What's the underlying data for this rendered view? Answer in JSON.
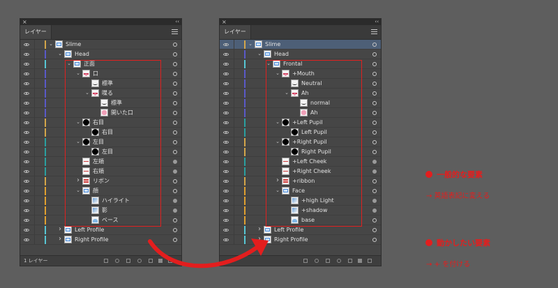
{
  "panel_left": {
    "tab": "レイヤー",
    "footer_count": "1 レイヤー",
    "rows": [
      {
        "label": "Slime",
        "level": 0,
        "chev": "down",
        "thumb": "blue",
        "color": "#d4a64a",
        "target": "hollow"
      },
      {
        "label": "Head",
        "level": 1,
        "chev": "down",
        "thumb": "blue",
        "color": "#5a59c9",
        "target": "hollow"
      },
      {
        "label": "正面",
        "level": 2,
        "chev": "down",
        "thumb": "blue",
        "color": "#57c7d4",
        "target": "hollow"
      },
      {
        "label": "口",
        "level": 3,
        "chev": "down",
        "thumb": "mouth",
        "color": "#5a59c9",
        "target": "hollow"
      },
      {
        "label": "標準",
        "level": 4,
        "chev": "",
        "thumb": "wave",
        "color": "#5a59c9",
        "target": "hollow"
      },
      {
        "label": "喋る",
        "level": 4,
        "chev": "down",
        "thumb": "mouth",
        "color": "#5a59c9",
        "target": "hollow"
      },
      {
        "label": "標準",
        "level": 5,
        "chev": "",
        "thumb": "wave",
        "color": "#5a59c9",
        "target": "hollow"
      },
      {
        "label": "開いた口",
        "level": 5,
        "chev": "",
        "thumb": "pink",
        "color": "#5a59c9",
        "target": "hollow"
      },
      {
        "label": "右目",
        "level": 3,
        "chev": "down",
        "thumb": "eye",
        "color": "#d4a64a",
        "target": "hollow"
      },
      {
        "label": "右目",
        "level": 4,
        "chev": "",
        "thumb": "eye",
        "color": "#d4a64a",
        "target": "hollow"
      },
      {
        "label": "左目",
        "level": 3,
        "chev": "down",
        "thumb": "eye",
        "color": "#2aa0a0",
        "target": "hollow"
      },
      {
        "label": "左目",
        "level": 4,
        "chev": "",
        "thumb": "eye",
        "color": "#2aa0a0",
        "target": "hollow"
      },
      {
        "label": "左頬",
        "level": 3,
        "chev": "",
        "thumb": "cheek",
        "color": "#2aa0a0",
        "target": "filled"
      },
      {
        "label": "右頬",
        "level": 3,
        "chev": "",
        "thumb": "cheek",
        "color": "#2aa0a0",
        "target": "filled"
      },
      {
        "label": "リボン",
        "level": 3,
        "chev": "right",
        "thumb": "ribbon",
        "color": "#d4a64a",
        "target": "hollow"
      },
      {
        "label": "顔",
        "level": 3,
        "chev": "down",
        "thumb": "blue",
        "color": "#e0a030",
        "target": "hollow"
      },
      {
        "label": "ハイライト",
        "level": 4,
        "chev": "",
        "thumb": "light",
        "color": "#e0a030",
        "target": "filled"
      },
      {
        "label": "影",
        "level": 4,
        "chev": "",
        "thumb": "light",
        "color": "#e0a030",
        "target": "filled"
      },
      {
        "label": "ベース",
        "level": 4,
        "chev": "",
        "thumb": "base",
        "color": "#e0a030",
        "target": "hollow"
      },
      {
        "label": "Left Profile",
        "level": 1,
        "chev": "right",
        "thumb": "blue",
        "color": "#57c7d4",
        "target": "hollow"
      },
      {
        "label": "Right Profile",
        "level": 1,
        "chev": "right",
        "thumb": "blue",
        "color": "#57c7d4",
        "target": "hollow"
      }
    ]
  },
  "panel_right": {
    "tab": "レイヤー",
    "rows": [
      {
        "label": "Slime",
        "level": 0,
        "chev": "down",
        "thumb": "blue",
        "color": "#d4a64a",
        "target": "hollow",
        "selected": true
      },
      {
        "label": "Head",
        "level": 1,
        "chev": "down",
        "thumb": "blue",
        "color": "#5a59c9",
        "target": "hollow"
      },
      {
        "label": "Frontal",
        "level": 2,
        "chev": "down",
        "thumb": "blue",
        "color": "#57c7d4",
        "target": "hollow"
      },
      {
        "label": "+Mouth",
        "level": 3,
        "chev": "down",
        "thumb": "mouth",
        "color": "#5a59c9",
        "target": "hollow"
      },
      {
        "label": "Neutral",
        "level": 4,
        "chev": "",
        "thumb": "wave",
        "color": "#5a59c9",
        "target": "hollow"
      },
      {
        "label": "Ah",
        "level": 4,
        "chev": "down",
        "thumb": "mouth",
        "color": "#5a59c9",
        "target": "hollow"
      },
      {
        "label": "normal",
        "level": 5,
        "chev": "",
        "thumb": "wave",
        "color": "#5a59c9",
        "target": "hollow"
      },
      {
        "label": "Ah",
        "level": 5,
        "chev": "",
        "thumb": "pink",
        "color": "#5a59c9",
        "target": "hollow"
      },
      {
        "label": "+Left Pupil",
        "level": 3,
        "chev": "down",
        "thumb": "eye",
        "color": "#2aa0a0",
        "target": "hollow"
      },
      {
        "label": "Left Pupil",
        "level": 4,
        "chev": "",
        "thumb": "eye",
        "color": "#2aa0a0",
        "target": "hollow"
      },
      {
        "label": "+Right Pupil",
        "level": 3,
        "chev": "down",
        "thumb": "eye",
        "color": "#d4a64a",
        "target": "hollow"
      },
      {
        "label": "Right Pupil",
        "level": 4,
        "chev": "",
        "thumb": "eye",
        "color": "#d4a64a",
        "target": "hollow"
      },
      {
        "label": "+Left Cheek",
        "level": 3,
        "chev": "",
        "thumb": "cheek",
        "color": "#2aa0a0",
        "target": "filled"
      },
      {
        "label": "+Right Cheek",
        "level": 3,
        "chev": "",
        "thumb": "cheek",
        "color": "#2aa0a0",
        "target": "filled"
      },
      {
        "label": "+ribbon",
        "level": 3,
        "chev": "right",
        "thumb": "ribbon",
        "color": "#d4a64a",
        "target": "hollow"
      },
      {
        "label": "Face",
        "level": 3,
        "chev": "down",
        "thumb": "blue",
        "color": "#e0a030",
        "target": "hollow"
      },
      {
        "label": "+high Light",
        "level": 4,
        "chev": "",
        "thumb": "light",
        "color": "#e0a030",
        "target": "filled"
      },
      {
        "label": "+shadow",
        "level": 4,
        "chev": "",
        "thumb": "light",
        "color": "#e0a030",
        "target": "filled"
      },
      {
        "label": "base",
        "level": 4,
        "chev": "",
        "thumb": "base",
        "color": "#e0a030",
        "target": "hollow"
      },
      {
        "label": "Left Profile",
        "level": 1,
        "chev": "right",
        "thumb": "blue",
        "color": "#57c7d4",
        "target": "hollow"
      },
      {
        "label": "Right Profile",
        "level": 1,
        "chev": "right",
        "thumb": "blue",
        "color": "#57c7d4",
        "target": "hollow"
      }
    ]
  },
  "notes": {
    "note1_title": "一般的な要素",
    "note1_detail": "→ 英語表記に変える",
    "note2_title": "動かしたい要素",
    "note2_detail": "→ + を付ける"
  },
  "colors": {
    "annotation_red": "#e31e1e",
    "panel_bg": "#464646",
    "selected_row": "#4d5f77"
  }
}
